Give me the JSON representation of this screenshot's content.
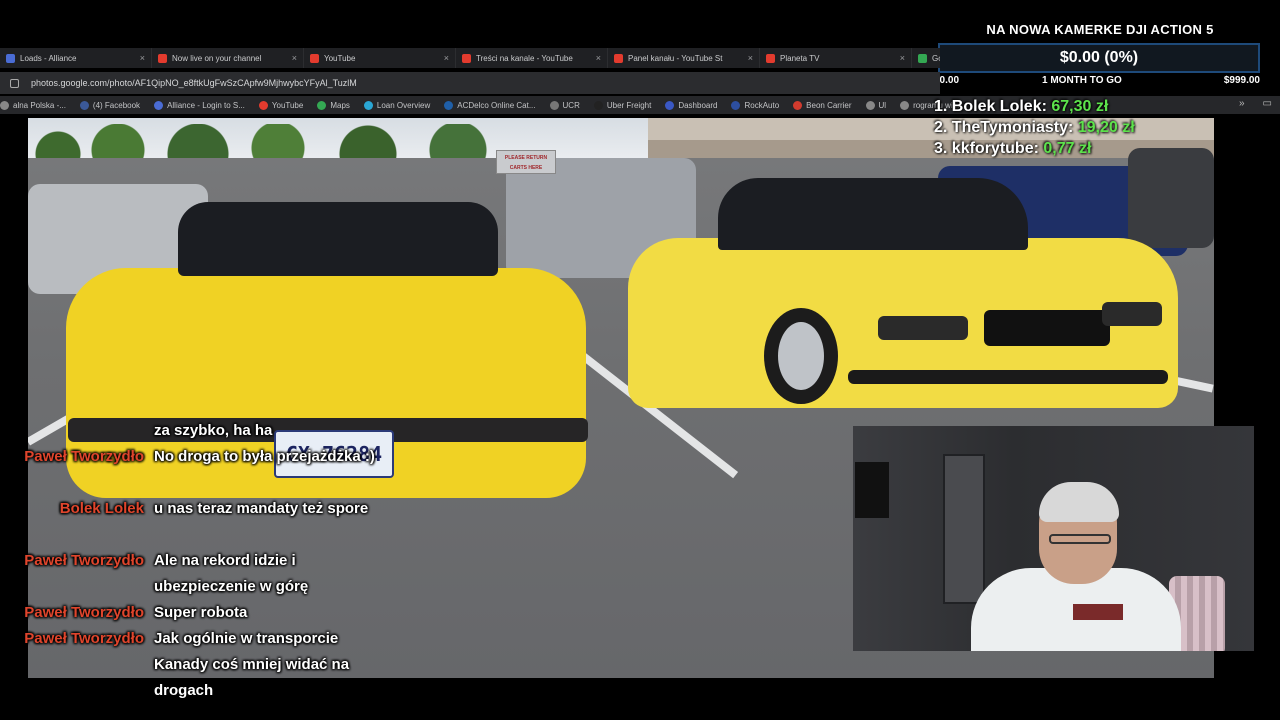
{
  "browser": {
    "tabs": [
      {
        "label": "Loads - Alliance",
        "color": "#4a6cd4"
      },
      {
        "label": "Now live on your channel",
        "color": "#e33b2e"
      },
      {
        "label": "YouTube",
        "color": "#e33b2e"
      },
      {
        "label": "Treści na kanale - YouTube",
        "color": "#e33b2e"
      },
      {
        "label": "Panel kanału - YouTube St",
        "color": "#e33b2e"
      },
      {
        "label": "Planeta TV",
        "color": "#e33b2e"
      },
      {
        "label": "Google Maps",
        "color": "#34a853"
      }
    ],
    "close_glyph": "×",
    "url": "photos.google.com/photo/AF1QipNO_e8ftkUgFwSzCApfw9MjhwybcYFyAl_TuzlM",
    "bookmarks": [
      {
        "label": "alna Polska -...",
        "color": "#888888"
      },
      {
        "label": "(4) Facebook",
        "color": "#3b5998"
      },
      {
        "label": "Alliance - Login to S...",
        "color": "#4a6cd4"
      },
      {
        "label": "YouTube",
        "color": "#e33b2e"
      },
      {
        "label": "Maps",
        "color": "#34a853"
      },
      {
        "label": "Loan Overview",
        "color": "#2aa6d4"
      },
      {
        "label": "ACDelco Online Cat...",
        "color": "#1f5fa8"
      },
      {
        "label": "UCR",
        "color": "#777777"
      },
      {
        "label": "Uber Freight",
        "color": "#222222"
      },
      {
        "label": "Dashboard",
        "color": "#3a58c4"
      },
      {
        "label": "RockAuto",
        "color": "#2d4fa0"
      },
      {
        "label": "Beon Carrier",
        "color": "#d13b2e"
      },
      {
        "label": "Ul",
        "color": "#888888"
      },
      {
        "label": "rogramu wi...",
        "color": "#888888"
      }
    ],
    "bookmarks_more": "»",
    "folder_icon": "folder-icon"
  },
  "goal": {
    "title": "NA NOWA KAMERKE DJI ACTION 5",
    "progress": "$0.00 (0%)",
    "progress_fraction": 0,
    "start": "$0.00",
    "remaining": "1 MONTH TO GO",
    "end": "$999.00"
  },
  "leaderboard": [
    {
      "name": "1. Bolek Lolek: ",
      "amount": "67,30 zł"
    },
    {
      "name": "2. TheTymoniasty: ",
      "amount": "19,20 zł"
    },
    {
      "name": "3. kkforytube: ",
      "amount": "0,77 zł"
    }
  ],
  "photo": {
    "plate": "CX 76284",
    "sign": "PLEASE RETURN CARTS HERE"
  },
  "chat": [
    {
      "user": "",
      "text": "za szybko, ha ha"
    },
    {
      "user": "Paweł Tworzydło",
      "text": "No droga to była przejażdżka :)"
    },
    {
      "user": "Bolek Lolek",
      "text": "u nas teraz mandaty też spore"
    },
    {
      "user": "Paweł Tworzydło",
      "text": "Ale na rekord idzie i ubezpieczenie w górę"
    },
    {
      "user": "Paweł Tworzydło",
      "text": "Super robota"
    },
    {
      "user": "Paweł Tworzydło",
      "text": "Jak ogólnie w transporcie Kanady coś mniej widać na drogach"
    }
  ],
  "colors": {
    "chat_user": "#e0452c",
    "leader_amount": "#5de34c",
    "goal_border": "#1e4a7a",
    "car_yellow": "#f0d224"
  }
}
